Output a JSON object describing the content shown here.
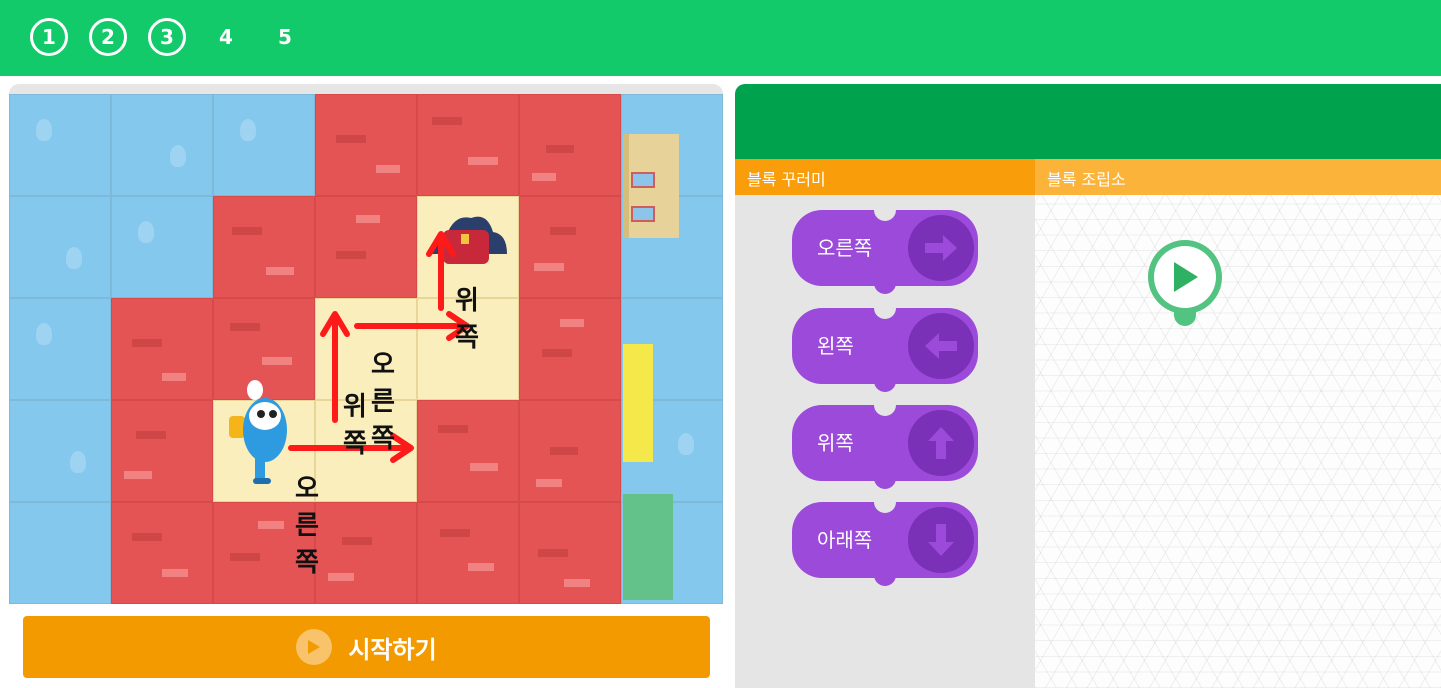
{
  "steps": [
    {
      "label": "1",
      "done": true
    },
    {
      "label": "2",
      "done": true
    },
    {
      "label": "3",
      "done": true
    },
    {
      "label": "4",
      "done": false
    },
    {
      "label": "5",
      "done": false
    }
  ],
  "game": {
    "hints": {
      "right_1": "오른쪽",
      "up_1": "위쪽",
      "right_2": "오른쪽",
      "up_2": "위쪽"
    },
    "run_button_label": "시작하기"
  },
  "panel": {
    "palette_title": "블록 꾸러미",
    "workspace_title": "블록 조립소",
    "blocks": [
      {
        "label": "오른쪽",
        "icon": "arrow-right-icon"
      },
      {
        "label": "왼쪽",
        "icon": "arrow-left-icon"
      },
      {
        "label": "위쪽",
        "icon": "arrow-up-icon"
      },
      {
        "label": "아래쪽",
        "icon": "arrow-down-icon"
      }
    ],
    "start_block_icon": "play-icon"
  },
  "colors": {
    "topbar": "#12ca69",
    "header": "#01a24d",
    "palette_head": "#f99d0b",
    "workspace_head": "#fbb33a",
    "block": "#9b4ad9",
    "run_button": "#f39a00"
  }
}
